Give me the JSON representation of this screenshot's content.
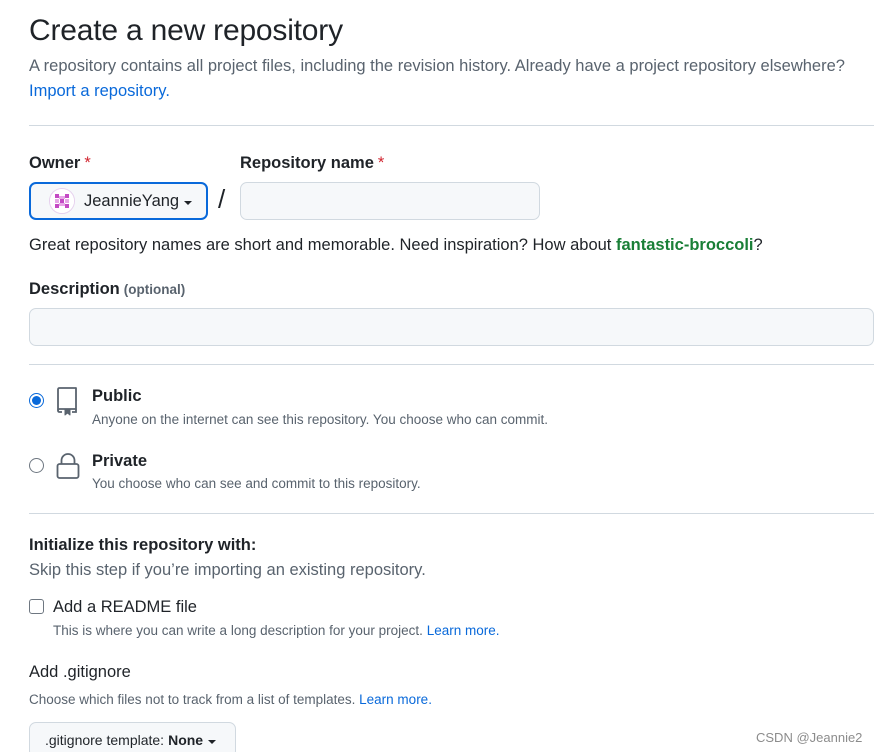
{
  "header": {
    "title": "Create a new repository",
    "subtitle": "A repository contains all project files, including the revision history. Already have a project repository elsewhere?",
    "import_link": "Import a repository."
  },
  "owner": {
    "label": "Owner",
    "required_mark": "*",
    "value": "JeannieYang"
  },
  "separator": "/",
  "repo_name": {
    "label": "Repository name",
    "required_mark": "*",
    "value": "",
    "placeholder": ""
  },
  "name_hint": {
    "text": "Great repository names are short and memorable. Need inspiration? How about ",
    "suggestion": "fantastic-broccoli",
    "suffix": "?"
  },
  "description": {
    "label": "Description",
    "optional": "(optional)",
    "value": "",
    "placeholder": ""
  },
  "visibility": {
    "selected": "public",
    "options": [
      {
        "title": "Public",
        "desc": "Anyone on the internet can see this repository. You choose who can commit.",
        "icon": "repo-icon"
      },
      {
        "title": "Private",
        "desc": "You choose who can see and commit to this repository.",
        "icon": "lock-icon"
      }
    ]
  },
  "init": {
    "title": "Initialize this repository with:",
    "subtitle": "Skip this step if you’re importing an existing repository.",
    "readme": {
      "label": "Add a README file",
      "checked": false,
      "desc": "This is where you can write a long description for your project.",
      "learn_more": "Learn more."
    },
    "gitignore": {
      "title": "Add .gitignore",
      "desc": "Choose which files not to track from a list of templates.",
      "learn_more": "Learn more.",
      "button_label": ".gitignore template:",
      "button_value": "None"
    }
  },
  "watermark": "CSDN @Jeannie2",
  "colors": {
    "accent": "#0969da",
    "suggestion": "#1a7f37",
    "required": "#d1242f",
    "avatar": "#c44ac4"
  }
}
